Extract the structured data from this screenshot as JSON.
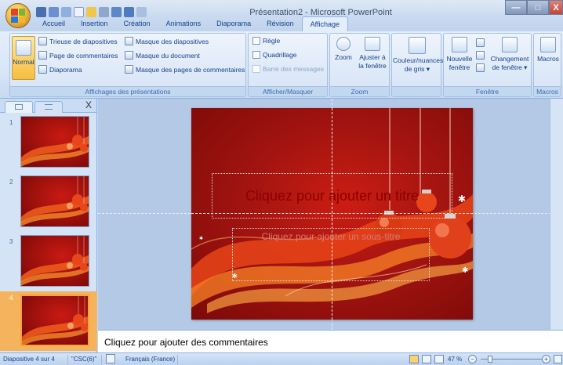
{
  "window": {
    "title": "Présentation2 - Microsoft PowerPoint"
  },
  "tabs": [
    "Accueil",
    "Insertion",
    "Création",
    "Animations",
    "Diaporama",
    "Révision",
    "Affichage"
  ],
  "active_tab": "Affichage",
  "ribbon": {
    "presentation_views": {
      "label": "Affichages des présentations",
      "normal": "Normal",
      "sorter": "Trieuse de diapositives",
      "notes_page": "Page de commentaires",
      "slideshow": "Diaporama",
      "slide_master": "Masque des diapositives",
      "handout_master": "Masque du document",
      "notes_master": "Masque des pages de commentaires"
    },
    "show_hide": {
      "label": "Afficher/Masquer",
      "ruler": "Règle",
      "gridlines": "Quadrillage",
      "message_bar": "Barre des messages"
    },
    "zoom": {
      "label": "Zoom",
      "zoom": "Zoom",
      "fit1": "Ajuster à",
      "fit2": "la fenêtre"
    },
    "color": {
      "line1": "Couleur/nuances",
      "line2": "de gris ▾"
    },
    "window": {
      "label": "Fenêtre",
      "new1": "Nouvelle",
      "new2": "fenêtre",
      "switch1": "Changement",
      "switch2": "de fenêtre ▾"
    },
    "macros": {
      "label": "Macros",
      "macros": "Macros"
    }
  },
  "pane": {
    "close": "X",
    "slides": [
      "1",
      "2",
      "3",
      "4"
    ],
    "active_slide": 4
  },
  "slide": {
    "title_placeholder": "Cliquez pour ajouter un titre",
    "subtitle_placeholder": "Cliquez pour ajouter un sous-titre"
  },
  "notes": {
    "placeholder": "Cliquez pour ajouter des commentaires"
  },
  "status": {
    "slide_info": "Diapositive 4 sur 4",
    "theme": "\"CSC(6)\"",
    "language": "Français (France)",
    "zoom": "47 %"
  },
  "colors": {
    "ribbon_blue": "#bfdbff",
    "slide_red": "#a31410",
    "active_orange": "#f6b35d"
  }
}
